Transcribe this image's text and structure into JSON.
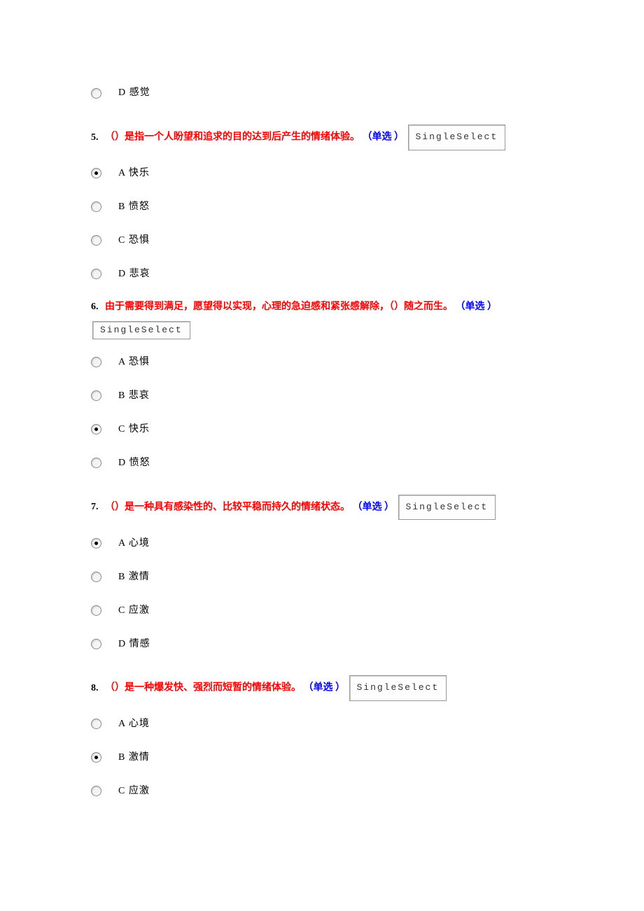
{
  "box_label": "SingleSelect",
  "q4": {
    "options": {
      "d": "D 感觉"
    }
  },
  "q5": {
    "num": "5.",
    "text": "（）是指一个人盼望和追求的目的达到后产生的情绪体验。",
    "type": "（单选 ）",
    "options": {
      "a": "A 快乐",
      "b": "B 愤怒",
      "c": "C 恐惧",
      "d": "D 悲哀"
    }
  },
  "q6": {
    "num": "6.",
    "text": "由于需要得到满足，愿望得以实现，心理的急迫感和紧张感解除，（）随之而生。",
    "type": "（单选 ）",
    "options": {
      "a": "A 恐惧",
      "b": "B 悲哀",
      "c": "C 快乐",
      "d": "D 愤怒"
    }
  },
  "q7": {
    "num": "7.",
    "text": "（）是一种具有感染性的、比较平稳而持久的情绪状态。",
    "type": "（单选 ）",
    "options": {
      "a": "A 心境",
      "b": "B 激情",
      "c": "C 应激",
      "d": "D 情感"
    }
  },
  "q8": {
    "num": "8.",
    "text": "（）是一种爆发快、强烈而短暂的情绪体验。",
    "type": "（单选 ）",
    "options": {
      "a": "A 心境",
      "b": "B 激情",
      "c": "C 应激"
    }
  }
}
